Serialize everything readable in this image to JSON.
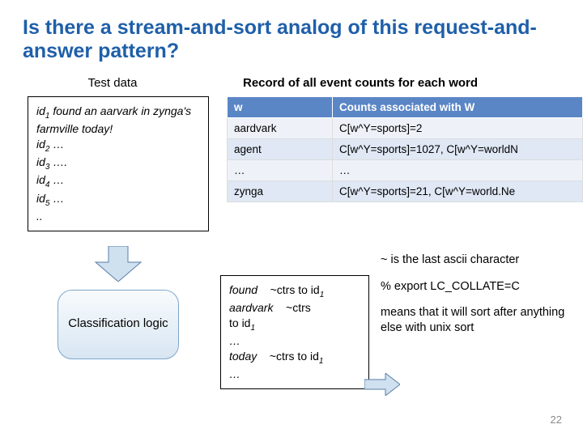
{
  "title": "Is there a stream-and-sort analog of this request-and-answer pattern?",
  "labels": {
    "testdata": "Test data",
    "record": "Record of all event counts for each word"
  },
  "testdata": {
    "line1_prefix": "id",
    "line1_sub": "1",
    "line1_rest": " found an aarvark in zynga's farmville today!",
    "lines": [
      {
        "id": "id",
        "sub": "2",
        "rest": " …"
      },
      {
        "id": "id",
        "sub": "3",
        "rest": " …."
      },
      {
        "id": "id",
        "sub": "4",
        "rest": " …"
      },
      {
        "id": "id",
        "sub": "5",
        "rest": " …"
      }
    ],
    "tail": ".."
  },
  "table": {
    "headers": {
      "w": "w",
      "counts": "Counts associated with W"
    },
    "rows": [
      {
        "w": "aardvark",
        "c": "C[w^Y=sports]=2"
      },
      {
        "w": "agent",
        "c": "C[w^Y=sports]=1027, C[w^Y=worldN"
      },
      {
        "w": "…",
        "c": "…"
      },
      {
        "w": "zynga",
        "c": "C[w^Y=sports]=21, C[w^Y=world.Ne"
      }
    ]
  },
  "classbox": "Classification logic",
  "output": {
    "l1a": "found",
    "l1b": "~ctrs to id",
    "l1sub": "1",
    "l2a": "aardvark",
    "l2b": "~ctrs",
    "l3a": "to id",
    "l3sub": "1",
    "l4": "…",
    "l5a": "today",
    "l5b": "~ctrs to id",
    "l5sub": "1",
    "l6": "…"
  },
  "explain": {
    "p1": "~ is the last ascii character",
    "p2": "% export LC_COLLATE=C",
    "p3": "means that it will sort after anything else with unix sort"
  },
  "slidenum": "22"
}
